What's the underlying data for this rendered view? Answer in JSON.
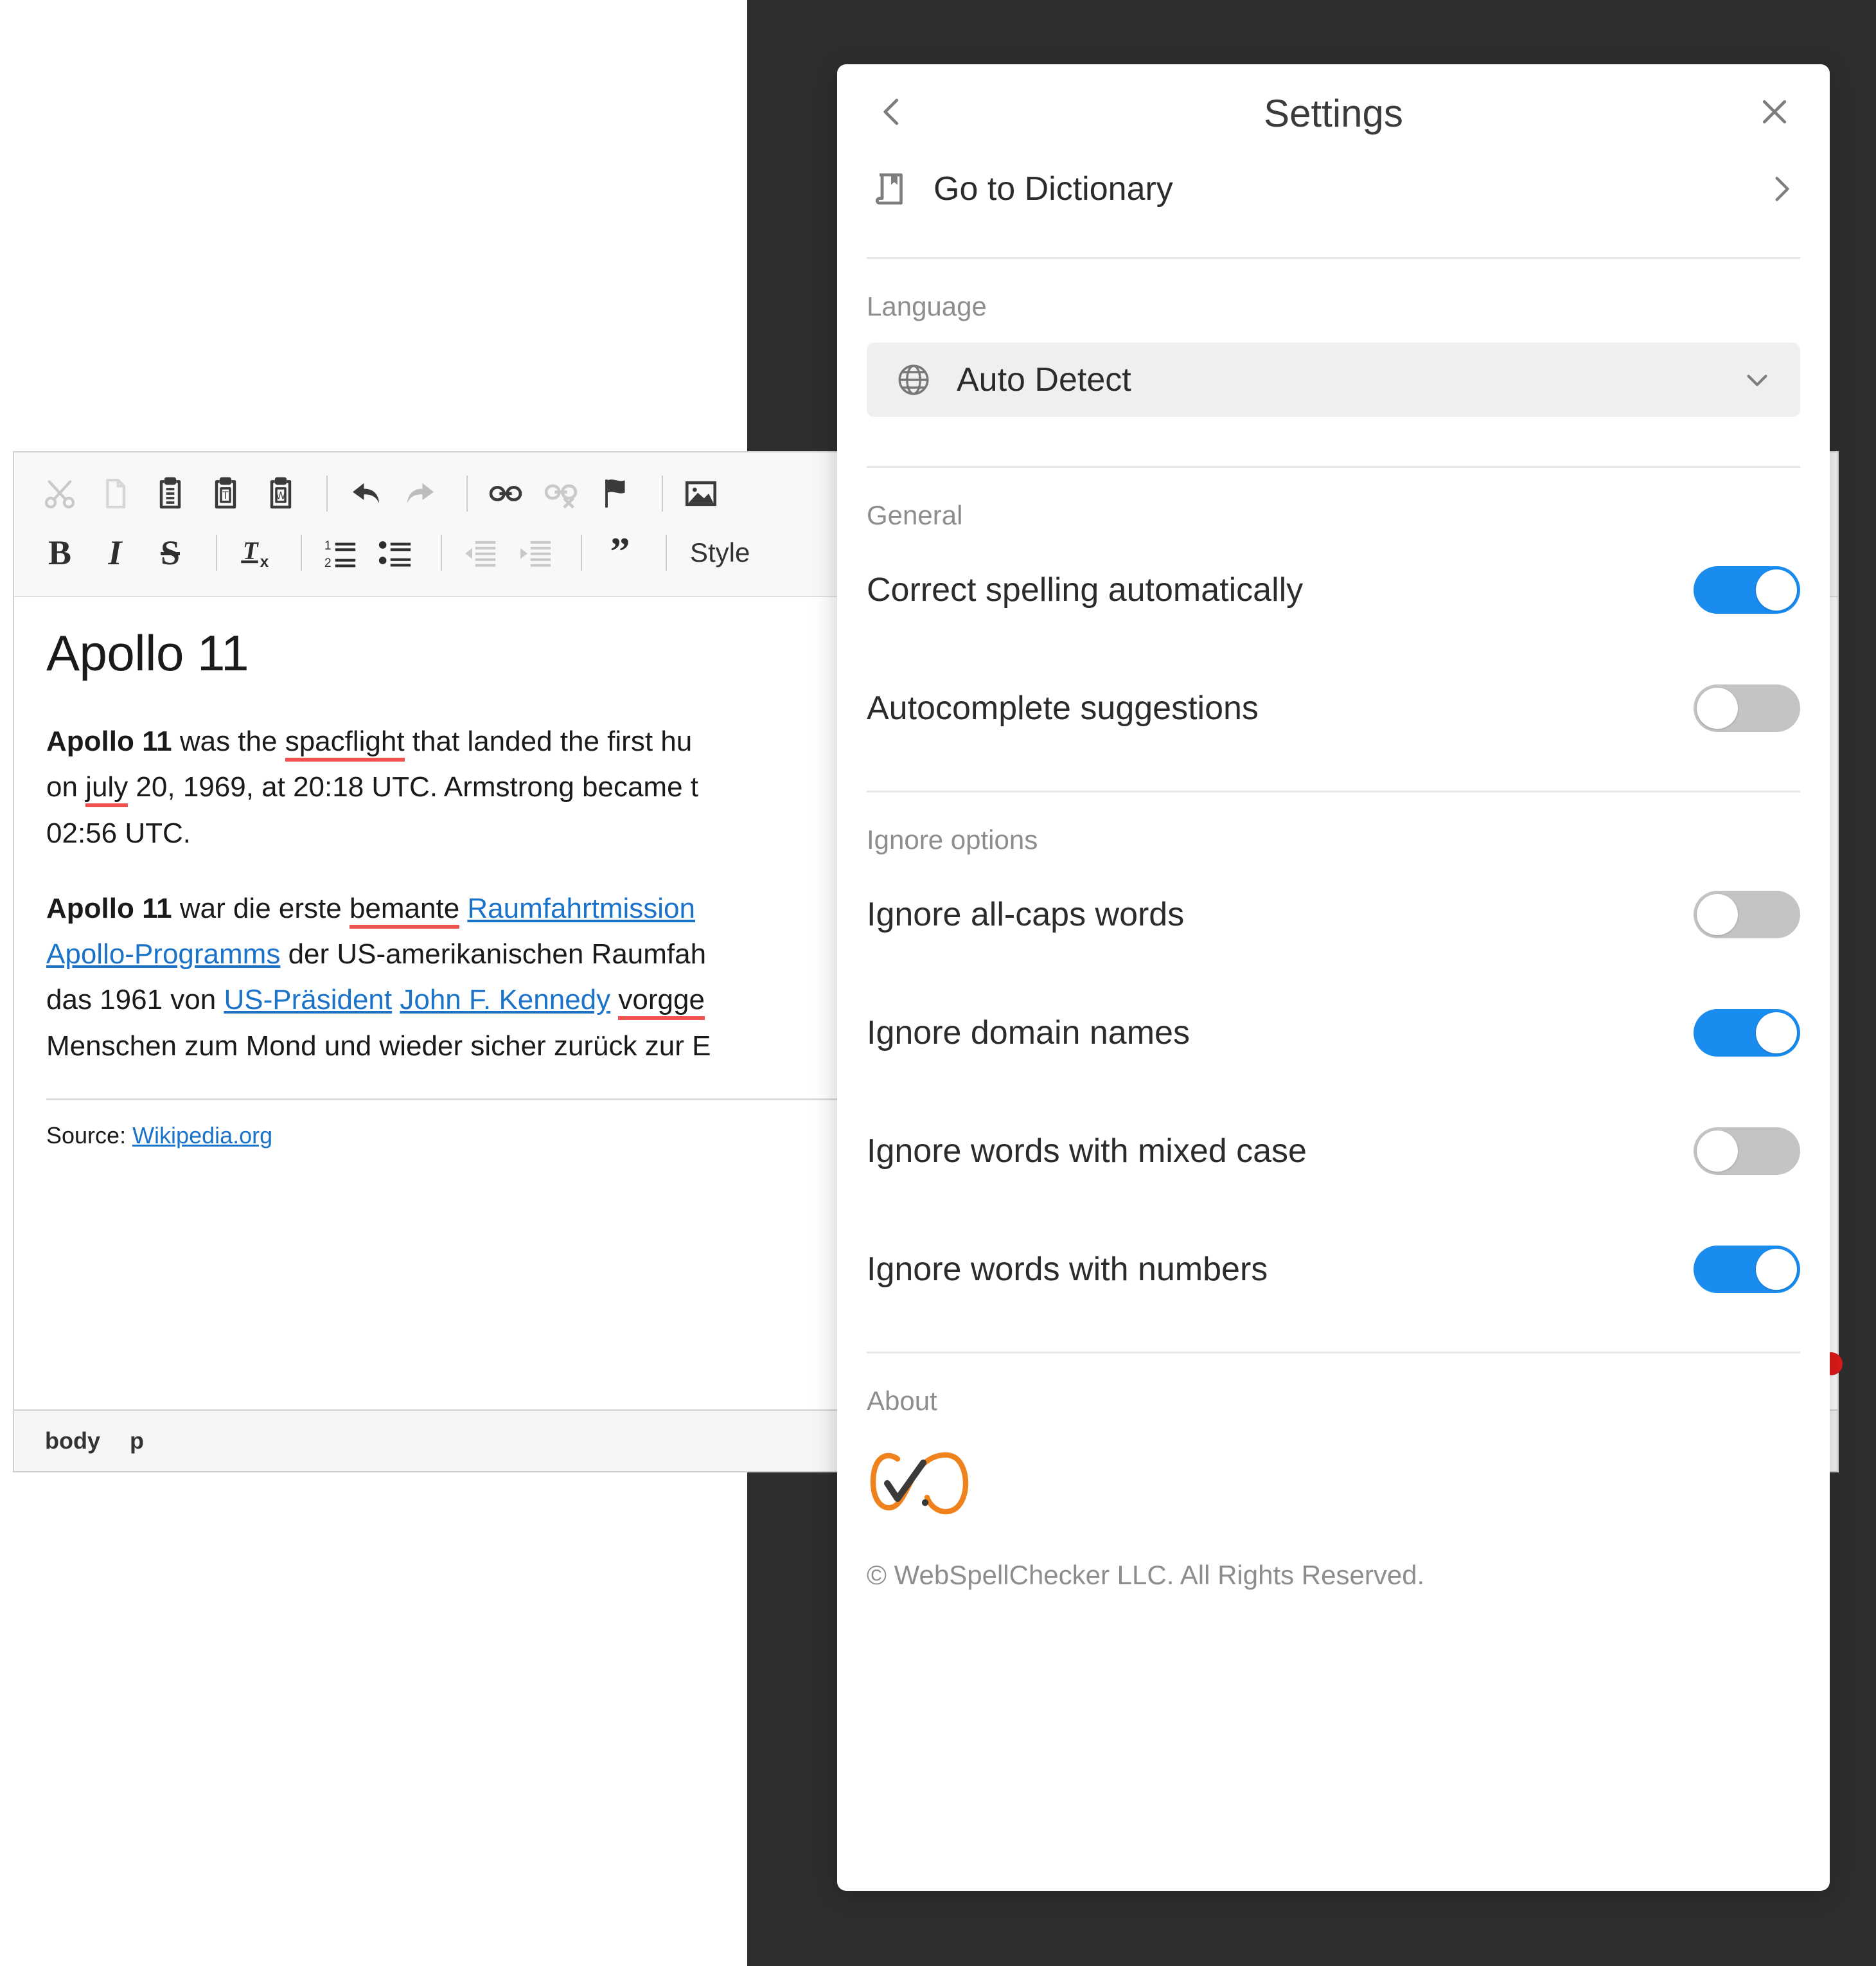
{
  "editor": {
    "toolbar": {
      "row1": [
        {
          "name": "cut",
          "label": "Cut",
          "disabled": true
        },
        {
          "name": "copy",
          "label": "Copy",
          "disabled": true
        },
        {
          "name": "paste",
          "label": "Paste",
          "disabled": false
        },
        {
          "name": "paste-as-plain-text",
          "label": "Paste as plain text",
          "disabled": false
        },
        {
          "name": "paste-from-word",
          "label": "Paste from Word",
          "disabled": false
        },
        {
          "name": "sep",
          "label": "",
          "disabled": false
        },
        {
          "name": "undo",
          "label": "Undo",
          "disabled": false
        },
        {
          "name": "redo",
          "label": "Redo",
          "disabled": true
        },
        {
          "name": "sep",
          "label": "",
          "disabled": false
        },
        {
          "name": "link",
          "label": "Link",
          "disabled": false
        },
        {
          "name": "unlink",
          "label": "Unlink",
          "disabled": true
        },
        {
          "name": "anchor",
          "label": "Anchor",
          "disabled": false
        },
        {
          "name": "sep",
          "label": "",
          "disabled": false
        },
        {
          "name": "image",
          "label": "Image",
          "disabled": false
        }
      ],
      "row2": [
        {
          "name": "bold",
          "label": "B",
          "disabled": false
        },
        {
          "name": "italic",
          "label": "I",
          "disabled": false
        },
        {
          "name": "strikethrough",
          "label": "S",
          "disabled": false
        },
        {
          "name": "sep",
          "label": "",
          "disabled": false
        },
        {
          "name": "remove-format",
          "label": "Remove Format",
          "disabled": false
        },
        {
          "name": "sep",
          "label": "",
          "disabled": false
        },
        {
          "name": "numbered-list",
          "label": "Insert/Remove Numbered List",
          "disabled": false
        },
        {
          "name": "bulleted-list",
          "label": "Insert/Remove Bulleted List",
          "disabled": false
        },
        {
          "name": "sep",
          "label": "",
          "disabled": false
        },
        {
          "name": "outdent",
          "label": "Decrease Indent",
          "disabled": true
        },
        {
          "name": "indent",
          "label": "Increase Indent",
          "disabled": true
        },
        {
          "name": "sep",
          "label": "",
          "disabled": false
        },
        {
          "name": "blockquote",
          "label": "Block Quote",
          "disabled": false
        },
        {
          "name": "sep",
          "label": "",
          "disabled": false
        }
      ],
      "styles_label": "Style"
    },
    "document": {
      "title": "Apollo 11",
      "paragraph_en": {
        "bold_lead": "Apollo 11",
        "part1": " was the ",
        "misspelled1": "spacflight",
        "part2": " that landed the first hu",
        "part3": "on ",
        "misspelled2": "july",
        "part4": " 20, 1969, at 20:18 UTC. Armstrong became t",
        "part5": "02:56 UTC."
      },
      "paragraph_de": {
        "bold_lead": "Apollo 11",
        "line1_pre": " war die erste ",
        "line1_misspelled": "bemante",
        "line1_link": "Raumfahrtmission",
        "line2_link": "Apollo-Programms",
        "line2_text": " der US-amerikanischen Raumfah",
        "line3_pre": "das 1961 von ",
        "line3_link1": "US-Präsident",
        "line3_link2": "John F. Kennedy",
        "line3_misspelled": "vorgge",
        "line4": "Menschen zum Mond und wieder sicher zurück zur E"
      },
      "source_prefix": "Source: ",
      "source_link": "Wikipedia.org"
    },
    "statusbar": {
      "elements": [
        "body",
        "p"
      ]
    }
  },
  "settings": {
    "header": {
      "back_icon": "chevron-left-icon",
      "title": "Settings",
      "close_icon": "close-icon"
    },
    "dictionary": {
      "icon": "book-icon",
      "label": "Go to Dictionary",
      "chevron": "chevron-right-icon"
    },
    "language": {
      "section_label": "Language",
      "icon": "globe-icon",
      "selected": "Auto Detect",
      "chevron": "chevron-down-icon"
    },
    "general": {
      "section_label": "General",
      "options": [
        {
          "label": "Correct spelling automatically",
          "on": true
        },
        {
          "label": "Autocomplete suggestions",
          "on": false
        }
      ]
    },
    "ignore": {
      "section_label": "Ignore options",
      "options": [
        {
          "label": "Ignore all-caps words",
          "on": false
        },
        {
          "label": "Ignore domain names",
          "on": true
        },
        {
          "label": "Ignore words with mixed case",
          "on": false
        },
        {
          "label": "Ignore words with numbers",
          "on": true
        }
      ]
    },
    "about": {
      "section_label": "About",
      "logo": "webspellchecker-logo",
      "copyright": "© WebSpellChecker LLC. All Rights Reserved."
    }
  },
  "colors": {
    "toggle_on": "#1a8cf0",
    "toggle_off": "#c4c4c4",
    "spelling_error": "#ef5350",
    "link": "#1a73c9",
    "logo_orange": "#f0821e",
    "backdrop": "#2e2e2e"
  }
}
